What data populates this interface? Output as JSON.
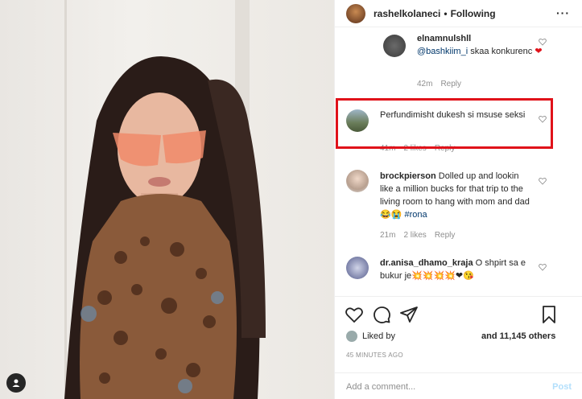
{
  "header": {
    "username": "rashelkolaneci",
    "separator": "•",
    "follow_status": "Following",
    "more": "···"
  },
  "comments": [
    {
      "username": "elnamnulshll",
      "mention": "@bashkiim_i",
      "text": " skaa konkurenc",
      "emoji": "❤",
      "time": "42m",
      "reply": "Reply"
    },
    {
      "text": "Perfundimisht dukesh si msuse seksi",
      "time": "41m",
      "likes": "2 likes",
      "reply": "Reply"
    },
    {
      "username": "brockpierson",
      "text": "Dolled up and lookin like a million bucks for that trip to the living room to hang with mom and dad",
      "emoji": "😂😭",
      "hashtag": "#rona",
      "time": "21m",
      "likes": "2 likes",
      "reply": "Reply"
    },
    {
      "username": "dr.anisa_dhamo_kraja",
      "text": "O shpirt sa e bukur je",
      "emoji": "💥💥💥💥❤😘"
    }
  ],
  "likes": {
    "liked_by": "Liked by",
    "and_others": "and 11,145 others"
  },
  "timestamp": "45 MINUTES AGO",
  "add_comment": {
    "placeholder": "Add a comment...",
    "post": "Post"
  },
  "colors": {
    "highlight": "#e0121a",
    "link": "#00376b",
    "muted": "#8e8e8e"
  }
}
